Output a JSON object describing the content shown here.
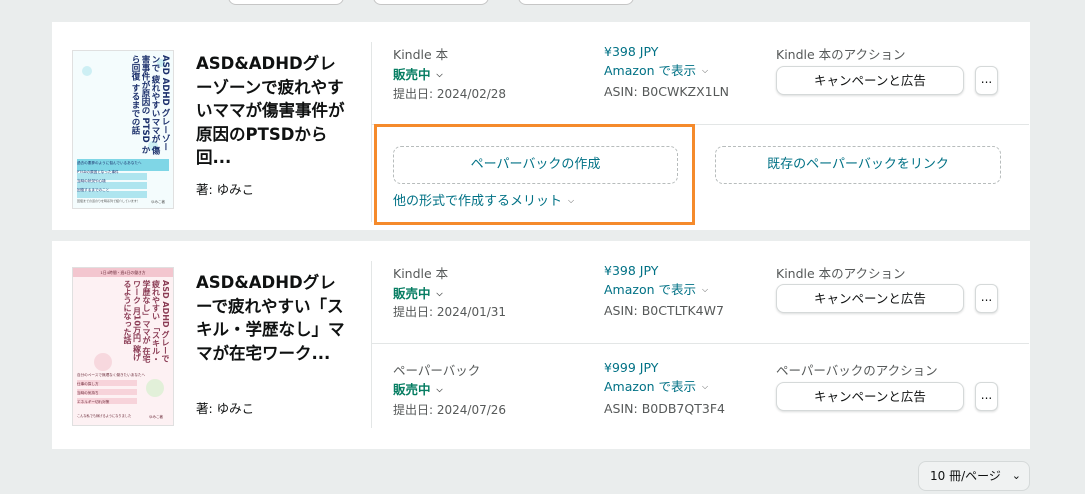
{
  "books": [
    {
      "title": "ASD&ADHDグレーゾーンで疲れやすいママが傷害事件が原因のPTSDから回...",
      "author": "著: ゆみこ",
      "cover": {
        "text_lines": [
          "ASD",
          "ADHD",
          "グレーゾーンで",
          "疲れやすいママが",
          "傷害事件が原因の",
          "PTSD",
          "から回復",
          "するまでの話"
        ],
        "sub_lines": [
          "過去の悪夢のように悩んでいるあなたへ",
          "PTSDの原因となった事件",
          "当時の状況や心境",
          "回復するまでのこと"
        ],
        "footer": "回復までの道のりを時系列で紹介しています！",
        "author": "ゆみこ著",
        "accent": "#7fd6e6"
      },
      "formats": [
        {
          "format": "Kindle 本",
          "status": "販売中",
          "date": "提出日: 2024/02/28",
          "price": "¥398 JPY",
          "amazon_link": "Amazon で表示",
          "asin": "ASIN: B0CWKZX1LN",
          "action_label": "Kindle 本のアクション",
          "action_button": "キャンペーンと広告",
          "more": "..."
        }
      ],
      "create_paperback": "ペーパーバックの作成",
      "link_paperback": "既存のペーパーバックをリンク",
      "benefits_link": "他の形式で作成するメリット"
    },
    {
      "title": "ASD&ADHDグレーで疲れやすい「スキル・学歴なし」ママが在宅ワーク...",
      "author": "著: ゆみこ",
      "cover": {
        "text_lines": [
          "ASD",
          "ADHD",
          "グレーで疲れやすい",
          "「スキル・学歴なし」ママが",
          "在宅ワーク",
          "月10万円",
          "稼げるようになった話"
        ],
        "sub_lines": [
          "自分のペースで無理なく働きたいあなたへ",
          "仕事の探し方",
          "当時の気持ち",
          "エネルギー切れ対策"
        ],
        "footer": "こんな私でも稼げるようになりました",
        "badge": "1日4時間・週4日の働き方",
        "author": "ゆみこ著",
        "accent": "#f3c6cf"
      },
      "formats": [
        {
          "format": "Kindle 本",
          "status": "販売中",
          "date": "提出日: 2024/01/31",
          "price": "¥398 JPY",
          "amazon_link": "Amazon で表示",
          "asin": "ASIN: B0CTLTK4W7",
          "action_label": "Kindle 本のアクション",
          "action_button": "キャンペーンと広告",
          "more": "..."
        },
        {
          "format": "ペーパーバック",
          "status": "販売中",
          "date": "提出日: 2024/07/26",
          "price": "¥999 JPY",
          "amazon_link": "Amazon で表示",
          "asin": "ASIN: B0DB7QT3F4",
          "action_label": "ペーパーバックのアクション",
          "action_button": "キャンペーンと広告",
          "more": "..."
        }
      ]
    }
  ],
  "pagination": {
    "per_page": "10 冊/ページ"
  },
  "icons": {
    "dropdown": "chevron-down-icon"
  },
  "colors": {
    "link": "#007185",
    "status": "#067d62",
    "highlight": "#f58a2b"
  }
}
